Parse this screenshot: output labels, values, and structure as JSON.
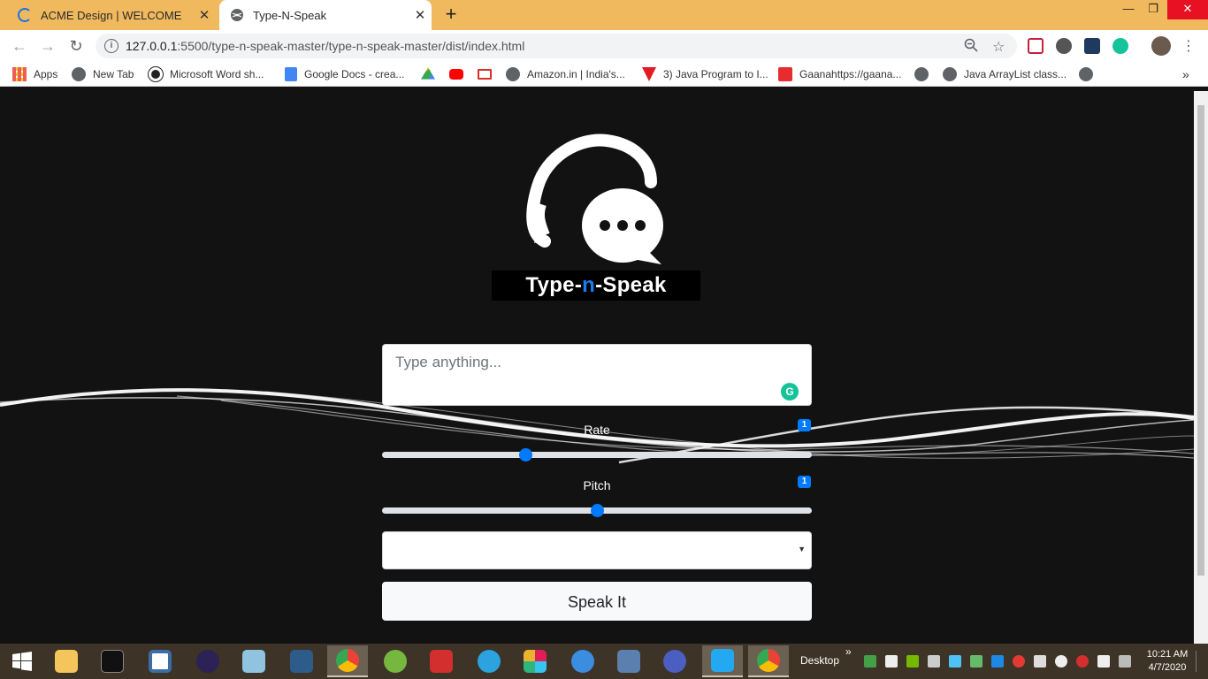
{
  "browser": {
    "tabs": [
      {
        "title": "ACME Design | WELCOME",
        "state": "loading"
      },
      {
        "title": "Type-N-Speak",
        "state": "active"
      }
    ],
    "url": {
      "host": "127.0.0.1",
      "rest": ":5500/type-n-speak-master/type-n-speak-master/dist/index.html"
    },
    "bookmarks": [
      {
        "label": "Apps",
        "icon": "apps-grid-icon"
      },
      {
        "label": "New Tab",
        "icon": "globe-icon"
      },
      {
        "label": "Microsoft Word sh...",
        "icon": "word-icon"
      },
      {
        "label": "Google Docs - crea...",
        "icon": "docs-icon"
      },
      {
        "label": "",
        "icon": "drive-icon"
      },
      {
        "label": "",
        "icon": "youtube-icon"
      },
      {
        "label": "",
        "icon": "gmail-icon"
      },
      {
        "label": "Amazon.in | India's...",
        "icon": "globe-icon"
      },
      {
        "label": "3) Java Program to I...",
        "icon": "vedantu-icon"
      },
      {
        "label": "Gaanahttps://gaana...",
        "icon": "gaana-icon"
      },
      {
        "label": "",
        "icon": "globe-icon"
      },
      {
        "label": "Java ArrayList class...",
        "icon": "globe-icon"
      },
      {
        "label": "",
        "icon": "globe-icon"
      }
    ],
    "more_bookmarks": "»"
  },
  "app": {
    "brand_parts": [
      "Type-",
      "n",
      "-Speak"
    ],
    "text_placeholder": "Type anything...",
    "grammarly": "G",
    "rate": {
      "label": "Rate",
      "badge": "1",
      "value": 1,
      "min": 0.5,
      "max": 2
    },
    "pitch": {
      "label": "Pitch",
      "badge": "1",
      "value": 1,
      "min": 0,
      "max": 2
    },
    "voice_selected": "",
    "speak_button": "Speak It"
  },
  "taskbar": {
    "desktop_label": "Desktop",
    "chevron": "»",
    "time": "10:21 AM",
    "date": "4/7/2020"
  },
  "colors": {
    "accent": "#007bff",
    "tabstrip": "#f0b95e",
    "page_bg": "#121212",
    "brand_n": "#1a7ef0"
  }
}
